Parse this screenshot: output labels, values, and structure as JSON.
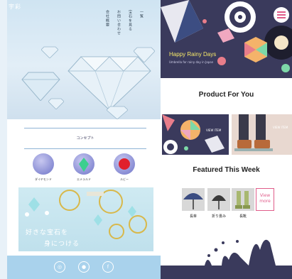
{
  "left": {
    "brand": "宇彩",
    "nav": [
      "一覧",
      "宝石を見る",
      "お問い合わせ",
      "会社概要"
    ],
    "concept_label": "コンセプト",
    "gems": [
      "ダイヤモンド",
      "エメラルド",
      "ルビー"
    ],
    "jewelry_line1": "好きな宝石を",
    "jewelry_line2": "身につける",
    "social_icons": [
      "instagram-icon",
      "line-icon",
      "facebook-icon"
    ]
  },
  "right": {
    "banner_title": "Happy Rainy Days",
    "banner_sub": "Umbrella for rainy day in Japan",
    "section1": "Product For You",
    "view_labels": [
      "VIEW ITEM",
      "VIEW ITEM"
    ],
    "section2": "Featured This Week",
    "items": [
      "長傘",
      "折り畳み",
      "長靴"
    ],
    "view_more": "View more"
  },
  "colors": {
    "accent_pink": "#e05c8a",
    "banner_bg": "#3a3a5c",
    "sky": "#a9d2ec",
    "yellow": "#f7e96a"
  }
}
